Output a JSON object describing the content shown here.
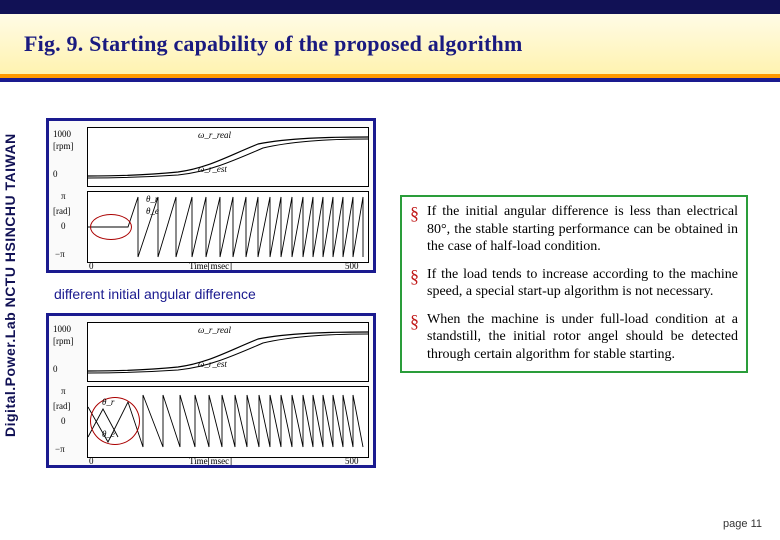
{
  "title": "Fig. 9. Starting capability of the proposed algorithm",
  "sidebar": "Digital.Power.Lab NCTU HSINCHU TAIWAN",
  "mid_caption": "different initial angular difference",
  "bullets": [
    "If the initial angular difference is less than electrical 80°, the stable starting performance can be obtained in the case of half-load condition.",
    "If the load tends to increase according to the machine speed, a special start-up algorithm is not necessary.",
    "When the machine is under full-load condition at a standstill, the initial rotor angel should be detected through certain algorithm for stable starting."
  ],
  "page": "page 11",
  "chart_axis": {
    "y_top": "1000",
    "y_top_unit": "[rpm]",
    "y_top_zero": "0",
    "y_mid_pi": "π",
    "y_mid_unit": "[rad]",
    "y_mid_zero": "0",
    "y_mid_npi": "−π",
    "xlabel": "Time[msec]",
    "x0": "0",
    "x1": "500",
    "trace1": "ω_r_real",
    "trace2": "ω_r_est",
    "trace3": "θ_r",
    "trace4": "θ_e"
  }
}
